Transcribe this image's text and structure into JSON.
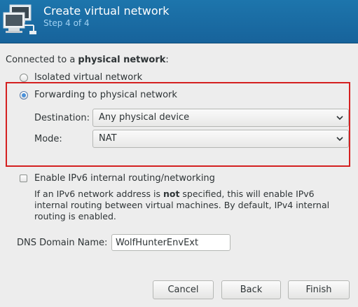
{
  "header": {
    "title": "Create virtual network",
    "step": "Step 4 of 4",
    "icon": "network-computers-icon"
  },
  "connection": {
    "label_prefix": "Connected to a ",
    "label_bold": "physical network",
    "label_suffix": ":",
    "isolated_label": "Isolated virtual network",
    "isolated_selected": false,
    "forwarding_label": "Forwarding to physical network",
    "forwarding_selected": true,
    "destination_label": "Destination:",
    "destination_value": "Any physical device",
    "mode_label": "Mode:",
    "mode_value": "NAT",
    "highlight_color": "#d42020"
  },
  "ipv6": {
    "label": "Enable IPv6 internal routing/networking",
    "checked": false,
    "desc_part1": "If an IPv6 network address is ",
    "desc_bold": "not",
    "desc_part2": " specified, this will enable IPv6 internal routing between virtual machines.  By default, IPv4 internal routing is enabled."
  },
  "dns": {
    "label": "DNS Domain Name:",
    "value": "WolfHunterEnvExt"
  },
  "buttons": {
    "cancel": "Cancel",
    "back": "Back",
    "finish": "Finish"
  },
  "colors": {
    "header_bg": "#1d75ac",
    "subtitle": "#9fd0f2",
    "window_bg": "#ededed"
  }
}
